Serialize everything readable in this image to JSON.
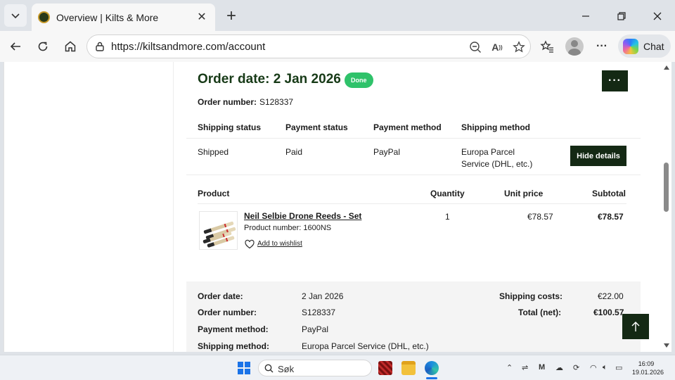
{
  "browser": {
    "tab_title": "Overview | Kilts & More",
    "url": "https://kiltsandmore.com/account",
    "chat_label": "Chat"
  },
  "order": {
    "title": "Order date: 2 Jan 2026",
    "status_badge": "Done",
    "more_button": "···",
    "number_label": "Order number:",
    "number_value": "S128337",
    "status_headers": [
      "Shipping status",
      "Payment status",
      "Payment method",
      "Shipping method"
    ],
    "status_values": {
      "shipping_status": "Shipped",
      "payment_status": "Paid",
      "payment_method": "PayPal",
      "shipping_method_line1": "Europa Parcel",
      "shipping_method_line2": "Service (DHL, etc.)"
    },
    "hide_details_button": "Hide details",
    "product_headers": {
      "product": "Product",
      "quantity": "Quantity",
      "unit_price": "Unit price",
      "subtotal": "Subtotal"
    },
    "product": {
      "name": "Neil Selbie Drone Reeds - Set",
      "product_number": "Product number: 1600NS",
      "wishlist": "Add to wishlist",
      "quantity": "1",
      "unit_price": "€78.57",
      "subtotal": "€78.57"
    },
    "summary": {
      "order_date_label": "Order date:",
      "order_date_value": "2 Jan 2026",
      "order_number_label": "Order number:",
      "order_number_value": "S128337",
      "payment_method_label": "Payment method:",
      "payment_method_value": "PayPal",
      "shipping_method_label": "Shipping method:",
      "shipping_method_value": "Europa Parcel Service (DHL, etc.)",
      "shipping_costs_label": "Shipping costs:",
      "shipping_costs_value": "€22.00",
      "total_label": "Total (net):",
      "total_value": "€100.57"
    }
  },
  "taskbar": {
    "search_placeholder": "Søk",
    "time": "16:09",
    "date": "19.01.2026"
  }
}
